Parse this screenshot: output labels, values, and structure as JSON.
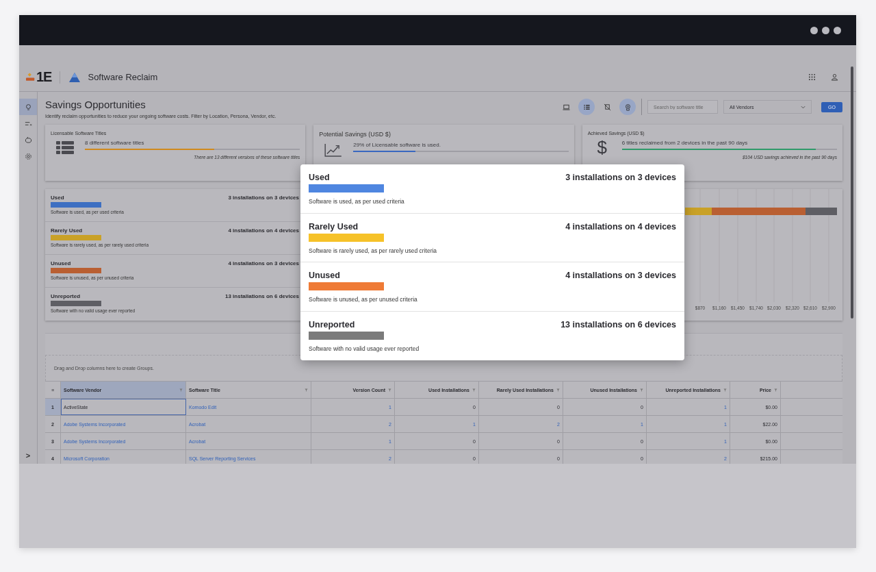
{
  "header": {
    "logo_text": "1E",
    "app_title": "Software Reclaim"
  },
  "sidebar": {
    "items": [
      {
        "selected": true
      },
      {
        "selected": false
      },
      {
        "selected": false
      },
      {
        "selected": false
      }
    ],
    "expand_glyph": ">"
  },
  "page": {
    "title": "Savings Opportunities",
    "subtitle": "Identify reclaim opportunities to reduce your ongoing software costs. Filter by Location, Persona, Vendor, etc."
  },
  "toolbar": {
    "views": [
      {
        "selected": false
      },
      {
        "selected": true
      },
      {
        "selected": false
      },
      {
        "selected": true
      }
    ],
    "search": {
      "placeholder": "Search by software title"
    },
    "vendor_select": {
      "value": "All Vendors"
    },
    "go_button": "GO"
  },
  "cards": [
    {
      "kind": "titles",
      "title": "Licensable Software Titles",
      "summary": "8 different software titles",
      "level": 0.6,
      "color": "#d08a1e",
      "note": "There are 13 different versions of these software titles"
    },
    {
      "kind": "potential",
      "title": "Potential Savings (USD $)",
      "summary": "29% of Licensable software is used.",
      "level": 0.29,
      "color": "#3a68c0"
    },
    {
      "kind": "achieved",
      "title": "Achieved Savings (USD $)",
      "glyph": "$",
      "summary": "6 titles reclaimed from 2 devices in the past 90 days",
      "level": 0.9,
      "color": "#2f9a6a",
      "note": "$104 USD savings achieved in the past 90 days"
    }
  ],
  "usage_statuses": [
    {
      "name": "Used",
      "count": "3 installations on 3 devices",
      "description": "Software is used, as per used criteria",
      "color": "#3d6fc2"
    },
    {
      "name": "Rarely Used",
      "count": "4 installations on 4 devices",
      "description": "Software is rarely used, as per rarely used criteria",
      "color": "#c9a127"
    },
    {
      "name": "Unused",
      "count": "4 installations on 3 devices",
      "description": "Software is unused, as per unused criteria",
      "color": "#b95f32"
    },
    {
      "name": "Unreported",
      "count": "13 installations on 6 devices",
      "description": "Software with no valid usage ever reported",
      "color": "#5e5e64"
    }
  ],
  "usage_chart": {
    "segments": [
      {
        "color": "#c9a127"
      },
      {
        "color": "#b95f32"
      },
      {
        "color": "#5e5e64"
      }
    ],
    "tick_labels": [
      "$870",
      "$1,160",
      "$1,450",
      "$1,740",
      "$2,030",
      "$2,320",
      "$2,610",
      "$2,900"
    ]
  },
  "popup": {
    "rows": [
      {
        "name": "Used",
        "count": "3 installations on 3 devices",
        "description": "Software is used, as per used criteria",
        "color": "#4f86e0"
      },
      {
        "name": "Rarely Used",
        "count": "4 installations on 4 devices",
        "description": "Software is rarely used, as per rarely used criteria",
        "color": "#f6c229"
      },
      {
        "name": "Unused",
        "count": "4 installations on 3 devices",
        "description": "Software is unused, as per unused criteria",
        "color": "#ef7b36"
      },
      {
        "name": "Unreported",
        "count": "13 installations on 6 devices",
        "description": "Software with no valid usage ever reported",
        "color": "#7b7b7b"
      }
    ]
  },
  "table": {
    "group_hint": "Drag and Drop columns here to create Groups.",
    "menu_glyph": "≡",
    "columns": [
      {
        "label": "Software Vendor",
        "selected": true
      },
      {
        "label": "Software Title",
        "selected": false
      },
      {
        "label": "Version Count",
        "selected": false
      },
      {
        "label": "Used Installations",
        "selected": false
      },
      {
        "label": "Rarely Used Installations",
        "selected": false
      },
      {
        "label": "Unused Installations",
        "selected": false
      },
      {
        "label": "Unreported Installations",
        "selected": false
      },
      {
        "label": "Price",
        "selected": false
      }
    ],
    "rows": [
      {
        "index": "1",
        "selected": true,
        "cells": [
          {
            "text": "ActiveState",
            "link": false
          },
          {
            "text": "Komodo Edit",
            "link": true
          },
          {
            "text": "1",
            "link": true
          },
          {
            "text": "0",
            "link": false
          },
          {
            "text": "0",
            "link": false
          },
          {
            "text": "0",
            "link": false
          },
          {
            "text": "1",
            "link": true
          },
          {
            "text": "$0.00",
            "link": false
          }
        ]
      },
      {
        "index": "2",
        "selected": false,
        "cells": [
          {
            "text": "Adobe Systems Incorporated",
            "link": true
          },
          {
            "text": "Acrobat",
            "link": true
          },
          {
            "text": "2",
            "link": true
          },
          {
            "text": "1",
            "link": true
          },
          {
            "text": "2",
            "link": true
          },
          {
            "text": "1",
            "link": true
          },
          {
            "text": "1",
            "link": true
          },
          {
            "text": "$22.00",
            "link": false
          }
        ]
      },
      {
        "index": "3",
        "selected": false,
        "cells": [
          {
            "text": "Adobe Systems Incorporated",
            "link": true
          },
          {
            "text": "Acrobat",
            "link": true
          },
          {
            "text": "1",
            "link": true
          },
          {
            "text": "0",
            "link": false
          },
          {
            "text": "0",
            "link": false
          },
          {
            "text": "0",
            "link": false
          },
          {
            "text": "1",
            "link": true
          },
          {
            "text": "$0.00",
            "link": false
          }
        ]
      },
      {
        "index": "4",
        "selected": false,
        "cells": [
          {
            "text": "Microsoft Corporation",
            "link": true
          },
          {
            "text": "SQL Server Reporting Services",
            "link": true
          },
          {
            "text": "2",
            "link": true
          },
          {
            "text": "0",
            "link": false
          },
          {
            "text": "0",
            "link": false
          },
          {
            "text": "0",
            "link": false
          },
          {
            "text": "2",
            "link": true
          },
          {
            "text": "$215.00",
            "link": false
          }
        ]
      }
    ]
  }
}
